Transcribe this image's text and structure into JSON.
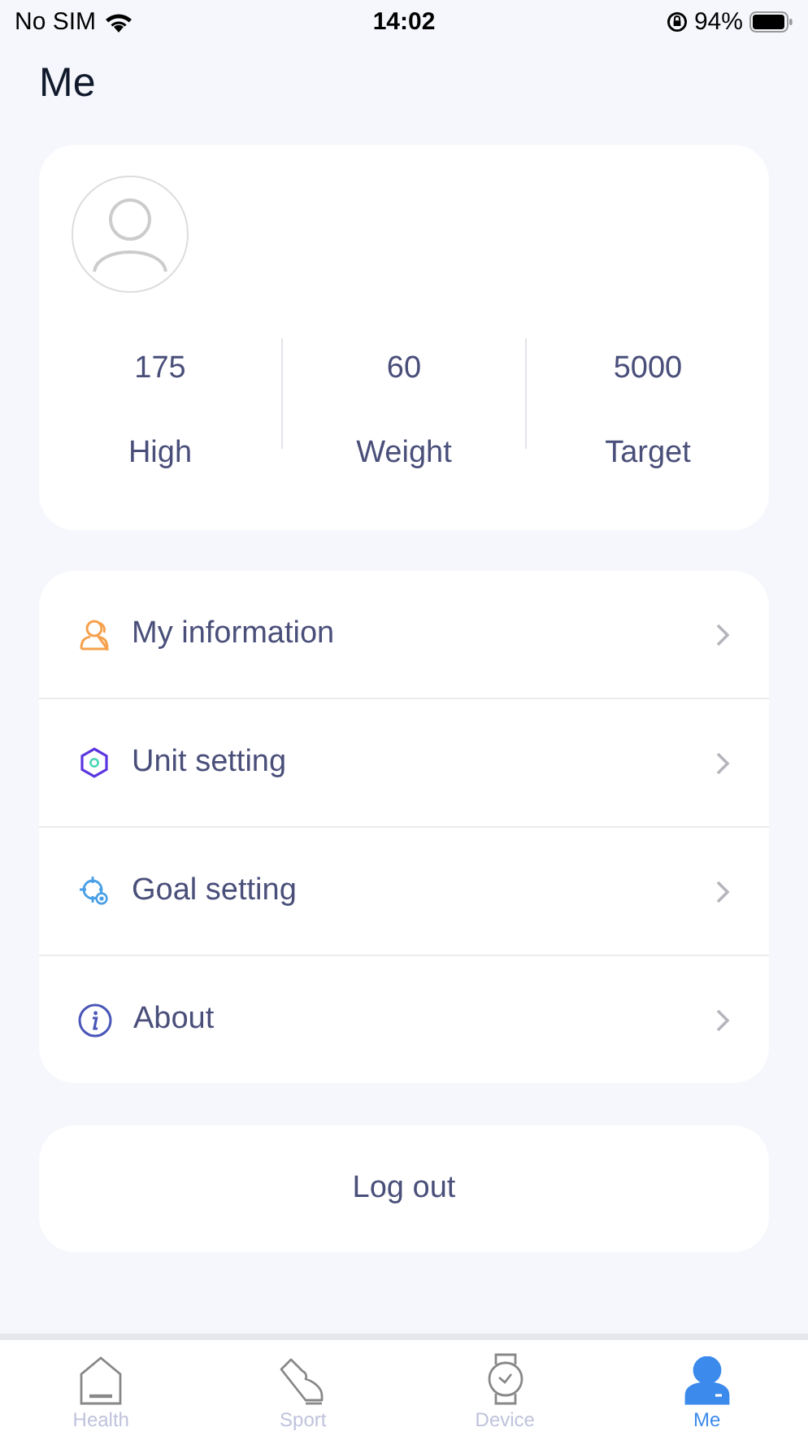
{
  "status_bar": {
    "carrier": "No SIM",
    "time": "14:02",
    "battery": "94%"
  },
  "title": "Me",
  "profile": {
    "stats": [
      {
        "value": "175",
        "label": "High"
      },
      {
        "value": "60",
        "label": "Weight"
      },
      {
        "value": "5000",
        "label": "Target"
      }
    ]
  },
  "menu": [
    {
      "label": "My information"
    },
    {
      "label": "Unit setting"
    },
    {
      "label": "Goal setting"
    },
    {
      "label": "About"
    }
  ],
  "logout": "Log out",
  "tabs": [
    {
      "label": "Health",
      "selected": false
    },
    {
      "label": "Sport",
      "selected": false
    },
    {
      "label": "Device",
      "selected": false
    },
    {
      "label": "Me",
      "selected": true
    }
  ]
}
